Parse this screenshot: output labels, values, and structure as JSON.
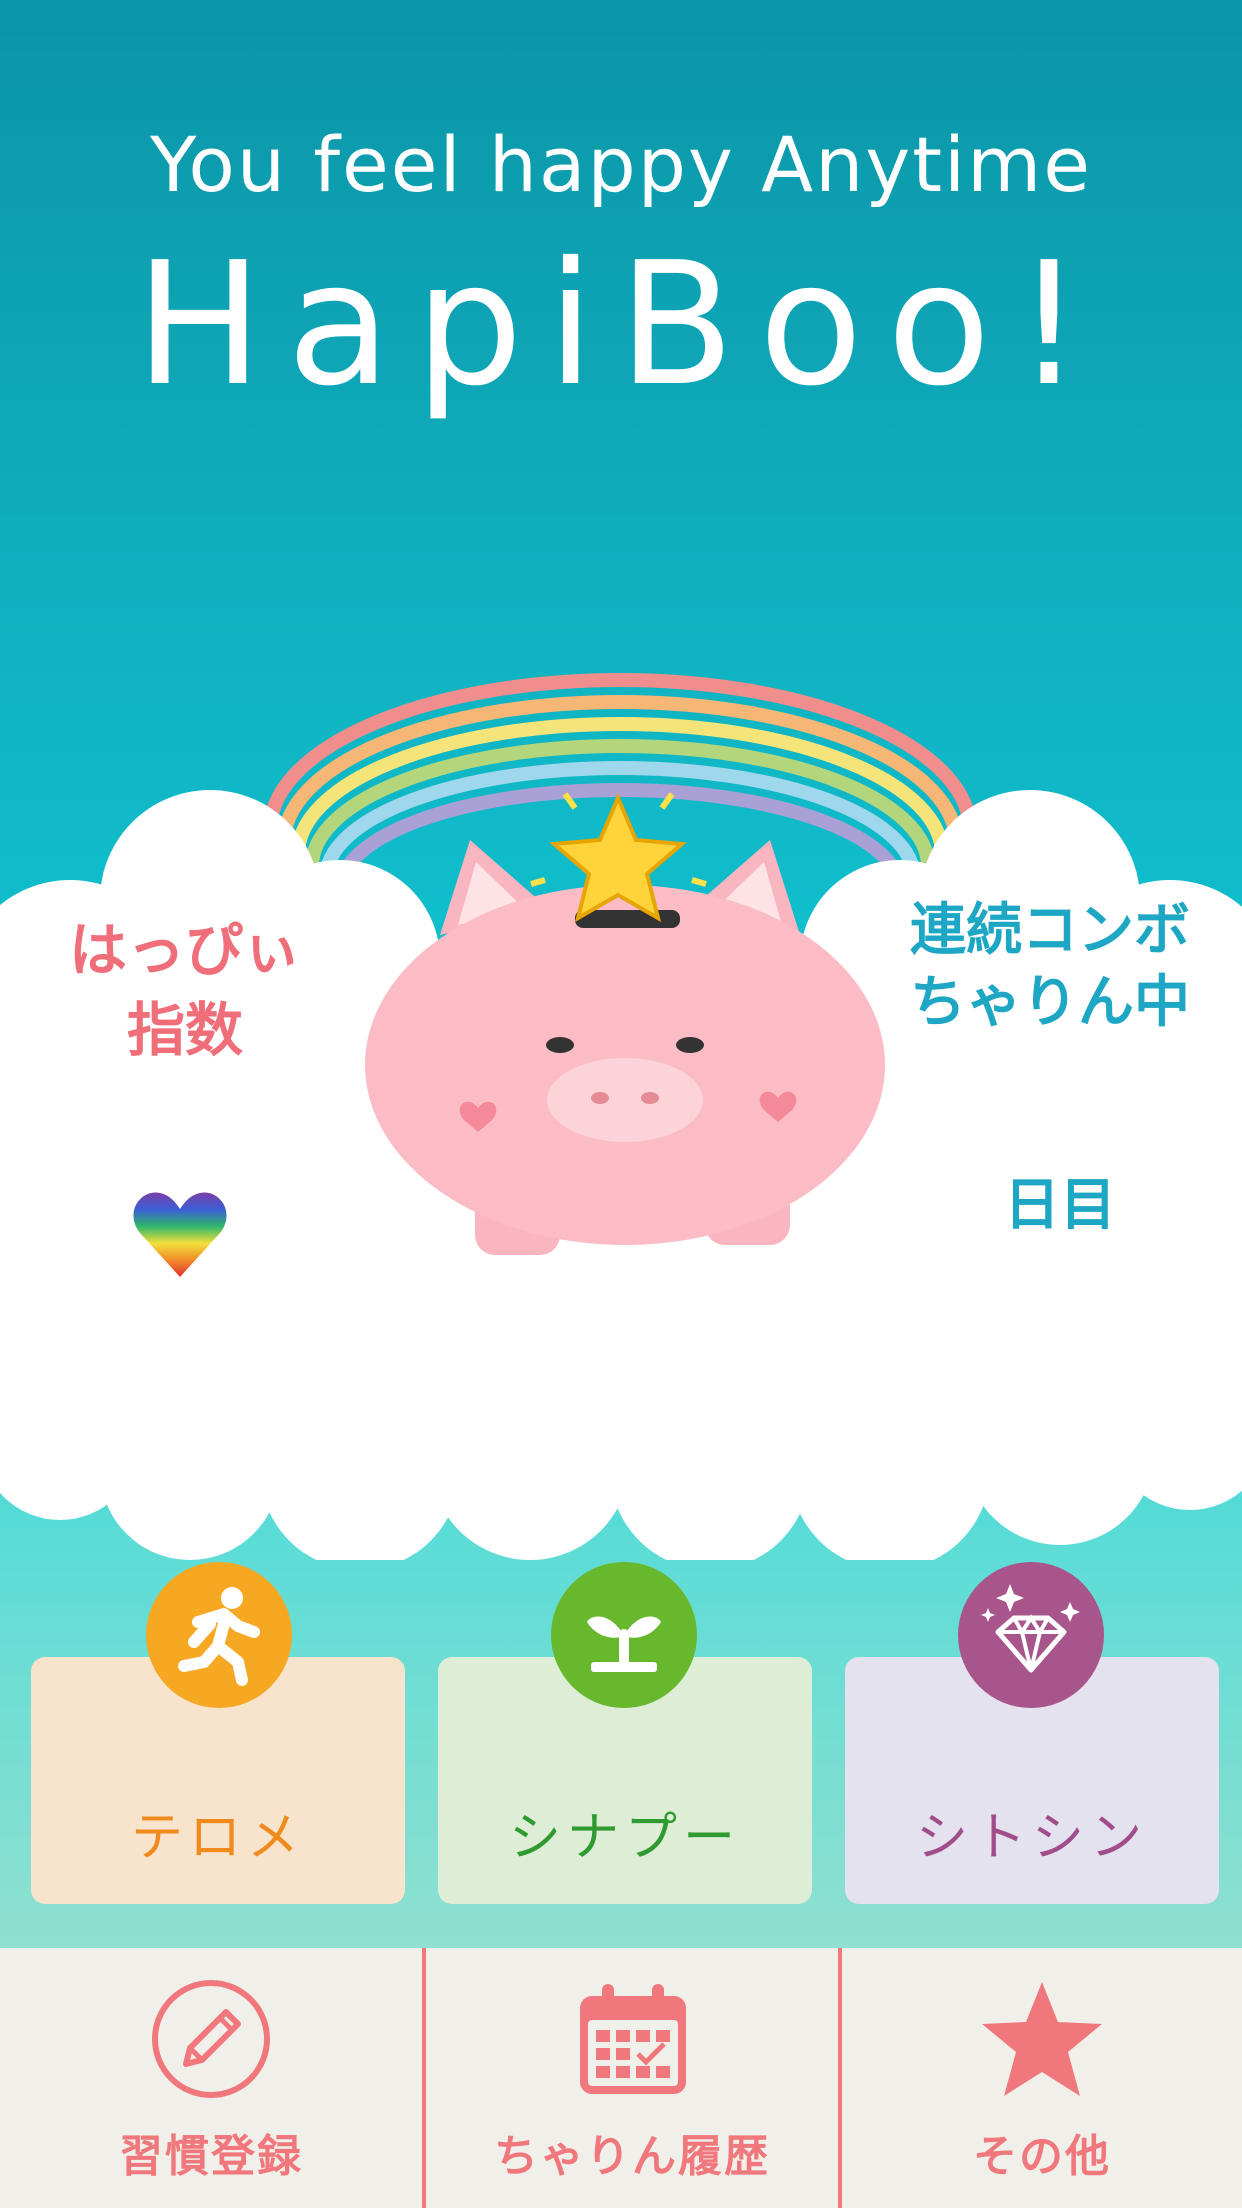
{
  "header": {
    "tagline": "You feel happy Anytime",
    "logo": "HapiBoo!"
  },
  "status": {
    "happy_index_label_line1": "はっぴぃ",
    "happy_index_label_line2": "指数",
    "combo_label_line1": "連続コンボ",
    "combo_label_line2": "ちゃりん中",
    "days_label": "日目"
  },
  "categories": [
    {
      "label": "テロメ",
      "icon": "running-person-icon",
      "circle_color": "#f6a823",
      "card_color": "#f8e3cc",
      "text_color": "#f08a1c"
    },
    {
      "label": "シナプー",
      "icon": "sprout-icon",
      "circle_color": "#67b82c",
      "card_color": "#deedd6",
      "text_color": "#2f9a2f"
    },
    {
      "label": "シトシン",
      "icon": "diamond-icon",
      "circle_color": "#a8558c",
      "card_color": "#e3e2ee",
      "text_color": "#a04d8c"
    }
  ],
  "tabbar": {
    "items": [
      {
        "label": "習慣登録",
        "icon": "pencil-icon"
      },
      {
        "label": "ちゃりん履歴",
        "icon": "calendar-icon"
      },
      {
        "label": "その他",
        "icon": "star-icon"
      }
    ],
    "accent_color": "#f0787c"
  }
}
